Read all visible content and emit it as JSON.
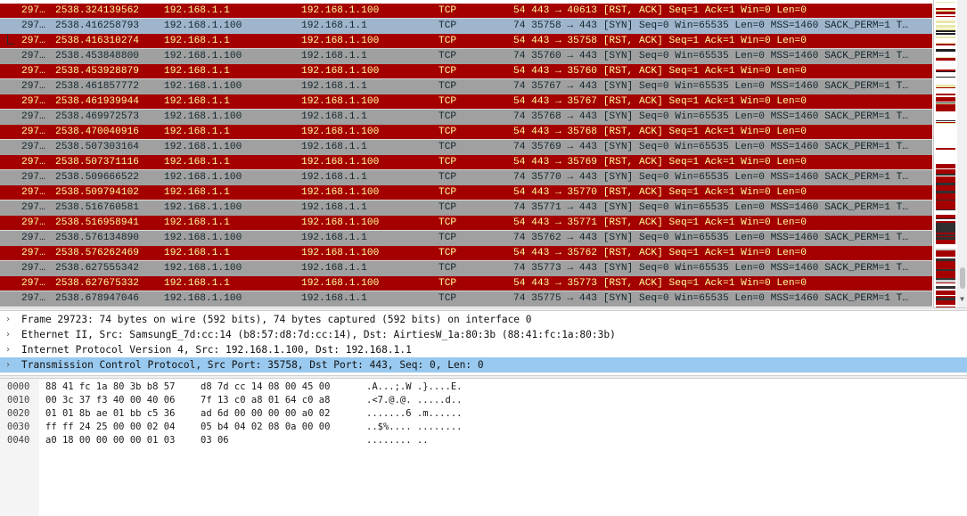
{
  "packets": [
    {
      "no": "297…",
      "time": "2538.324139562",
      "src": "192.168.1.1",
      "dst": "192.168.1.100",
      "proto": "TCP",
      "info": "54 443 → 40613 [RST, ACK] Seq=1 Ack=1 Win=0 Len=0",
      "kind": "rst"
    },
    {
      "no": "297…",
      "time": "2538.416258793",
      "src": "192.168.1.100",
      "dst": "192.168.1.1",
      "proto": "TCP",
      "info": "74 35758 → 443 [SYN] Seq=0 Win=65535 Len=0 MSS=1460 SACK_PERM=1 T…",
      "kind": "selected"
    },
    {
      "no": "297…",
      "time": "2538.416310274",
      "src": "192.168.1.1",
      "dst": "192.168.1.100",
      "proto": "TCP",
      "info": "54 443 → 35758 [RST, ACK] Seq=1 Ack=1 Win=0 Len=0",
      "kind": "rst",
      "related": true
    },
    {
      "no": "297…",
      "time": "2538.453848800",
      "src": "192.168.1.100",
      "dst": "192.168.1.1",
      "proto": "TCP",
      "info": "74 35760 → 443 [SYN] Seq=0 Win=65535 Len=0 MSS=1460 SACK_PERM=1 T…",
      "kind": "syn"
    },
    {
      "no": "297…",
      "time": "2538.453928879",
      "src": "192.168.1.1",
      "dst": "192.168.1.100",
      "proto": "TCP",
      "info": "54 443 → 35760 [RST, ACK] Seq=1 Ack=1 Win=0 Len=0",
      "kind": "rst"
    },
    {
      "no": "297…",
      "time": "2538.461857772",
      "src": "192.168.1.100",
      "dst": "192.168.1.1",
      "proto": "TCP",
      "info": "74 35767 → 443 [SYN] Seq=0 Win=65535 Len=0 MSS=1460 SACK_PERM=1 T…",
      "kind": "syn"
    },
    {
      "no": "297…",
      "time": "2538.461939944",
      "src": "192.168.1.1",
      "dst": "192.168.1.100",
      "proto": "TCP",
      "info": "54 443 → 35767 [RST, ACK] Seq=1 Ack=1 Win=0 Len=0",
      "kind": "rst"
    },
    {
      "no": "297…",
      "time": "2538.469972573",
      "src": "192.168.1.100",
      "dst": "192.168.1.1",
      "proto": "TCP",
      "info": "74 35768 → 443 [SYN] Seq=0 Win=65535 Len=0 MSS=1460 SACK_PERM=1 T…",
      "kind": "syn"
    },
    {
      "no": "297…",
      "time": "2538.470040916",
      "src": "192.168.1.1",
      "dst": "192.168.1.100",
      "proto": "TCP",
      "info": "54 443 → 35768 [RST, ACK] Seq=1 Ack=1 Win=0 Len=0",
      "kind": "rst"
    },
    {
      "no": "297…",
      "time": "2538.507303164",
      "src": "192.168.1.100",
      "dst": "192.168.1.1",
      "proto": "TCP",
      "info": "74 35769 → 443 [SYN] Seq=0 Win=65535 Len=0 MSS=1460 SACK_PERM=1 T…",
      "kind": "syn"
    },
    {
      "no": "297…",
      "time": "2538.507371116",
      "src": "192.168.1.1",
      "dst": "192.168.1.100",
      "proto": "TCP",
      "info": "54 443 → 35769 [RST, ACK] Seq=1 Ack=1 Win=0 Len=0",
      "kind": "rst"
    },
    {
      "no": "297…",
      "time": "2538.509666522",
      "src": "192.168.1.100",
      "dst": "192.168.1.1",
      "proto": "TCP",
      "info": "74 35770 → 443 [SYN] Seq=0 Win=65535 Len=0 MSS=1460 SACK_PERM=1 T…",
      "kind": "syn"
    },
    {
      "no": "297…",
      "time": "2538.509794102",
      "src": "192.168.1.1",
      "dst": "192.168.1.100",
      "proto": "TCP",
      "info": "54 443 → 35770 [RST, ACK] Seq=1 Ack=1 Win=0 Len=0",
      "kind": "rst"
    },
    {
      "no": "297…",
      "time": "2538.516760581",
      "src": "192.168.1.100",
      "dst": "192.168.1.1",
      "proto": "TCP",
      "info": "74 35771 → 443 [SYN] Seq=0 Win=65535 Len=0 MSS=1460 SACK_PERM=1 T…",
      "kind": "syn"
    },
    {
      "no": "297…",
      "time": "2538.516958941",
      "src": "192.168.1.1",
      "dst": "192.168.1.100",
      "proto": "TCP",
      "info": "54 443 → 35771 [RST, ACK] Seq=1 Ack=1 Win=0 Len=0",
      "kind": "rst"
    },
    {
      "no": "297…",
      "time": "2538.576134890",
      "src": "192.168.1.100",
      "dst": "192.168.1.1",
      "proto": "TCP",
      "info": "74 35762 → 443 [SYN] Seq=0 Win=65535 Len=0 MSS=1460 SACK_PERM=1 T…",
      "kind": "syn"
    },
    {
      "no": "297…",
      "time": "2538.576262469",
      "src": "192.168.1.1",
      "dst": "192.168.1.100",
      "proto": "TCP",
      "info": "54 443 → 35762 [RST, ACK] Seq=1 Ack=1 Win=0 Len=0",
      "kind": "rst"
    },
    {
      "no": "297…",
      "time": "2538.627555342",
      "src": "192.168.1.100",
      "dst": "192.168.1.1",
      "proto": "TCP",
      "info": "74 35773 → 443 [SYN] Seq=0 Win=65535 Len=0 MSS=1460 SACK_PERM=1 T…",
      "kind": "syn"
    },
    {
      "no": "297…",
      "time": "2538.627675332",
      "src": "192.168.1.1",
      "dst": "192.168.1.100",
      "proto": "TCP",
      "info": "54 443 → 35773 [RST, ACK] Seq=1 Ack=1 Win=0 Len=0",
      "kind": "rst"
    },
    {
      "no": "297…",
      "time": "2538.678947046",
      "src": "192.168.1.100",
      "dst": "192.168.1.1",
      "proto": "TCP",
      "info": "74 35775 → 443 [SYN] Seq=0 Win=65535 Len=0 MSS=1460 SACK_PERM=1 T…",
      "kind": "syn"
    }
  ],
  "details": [
    {
      "text": "Frame 29723: 74 bytes on wire (592 bits), 74 bytes captured (592 bits) on interface 0",
      "selected": false
    },
    {
      "text": "Ethernet II, Src: SamsungE_7d:cc:14 (b8:57:d8:7d:cc:14), Dst: AirtiesW_1a:80:3b (88:41:fc:1a:80:3b)",
      "selected": false
    },
    {
      "text": "Internet Protocol Version 4, Src: 192.168.1.100, Dst: 192.168.1.1",
      "selected": false
    },
    {
      "text": "Transmission Control Protocol, Src Port: 35758, Dst Port: 443, Seq: 0, Len: 0",
      "selected": true
    }
  ],
  "details_expander_glyph": "›",
  "hex_rows": [
    {
      "offset": "0000",
      "hex1": "88 41 fc 1a 80 3b b8 57",
      "hex2": "d8 7d cc 14 08 00 45 00",
      "ascii": ".A...;.W .}....E."
    },
    {
      "offset": "0010",
      "hex1": "00 3c 37 f3 40 00 40 06",
      "hex2": "7f 13 c0 a8 01 64 c0 a8",
      "ascii": ".<7.@.@. .....d.."
    },
    {
      "offset": "0020",
      "hex1": "01 01 8b ae 01 bb c5 36",
      "hex2": "ad 6d 00 00 00 00 a0 02",
      "ascii": ".......6 .m......"
    },
    {
      "offset": "0030",
      "hex1": "ff ff 24 25 00 00 02 04",
      "hex2": "05 b4 04 02 08 0a 00 00",
      "ascii": "..$%.... ........"
    },
    {
      "offset": "0040",
      "hex1": "a0 18 00 00 00 00 01 03",
      "hex2": "03 06",
      "ascii": "........ .."
    }
  ],
  "colors": {
    "rst_bg": "#a40000",
    "rst_fg": "#fffc9c",
    "syn_bg": "#a0a0a0",
    "selected_row_bg": "#9fb5cc",
    "selected_detail_bg": "#99c9ef"
  },
  "icons": {
    "expander": "chevron-right-icon",
    "scroll_down": "arrow-down-icon"
  }
}
